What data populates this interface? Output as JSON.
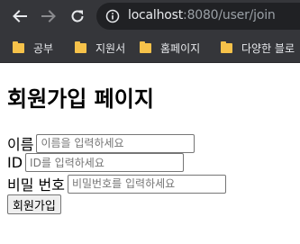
{
  "browser": {
    "url_host": "localhost",
    "url_rest": ":8080/user/join",
    "bookmarks": [
      {
        "label": "공부",
        "icon": "folder-icon"
      },
      {
        "label": "지원서",
        "icon": "folder-icon"
      },
      {
        "label": "홈페이지",
        "icon": "folder-icon"
      },
      {
        "label": "다양한 블로",
        "icon": "folder-icon"
      }
    ]
  },
  "page": {
    "title": "회원가입 페이지",
    "form": {
      "name_label": "이름",
      "name_placeholder": "이름을 입력하세요",
      "id_label": "ID",
      "id_placeholder": "ID를 입력하세요",
      "password_label": "비밀 번호",
      "password_placeholder": "비밀번호를 입력하세요",
      "submit_label": "회원가입"
    }
  },
  "colors": {
    "chrome_bg": "#35363a",
    "omnibox_bg": "#202124",
    "folder": "#f6c24a"
  }
}
